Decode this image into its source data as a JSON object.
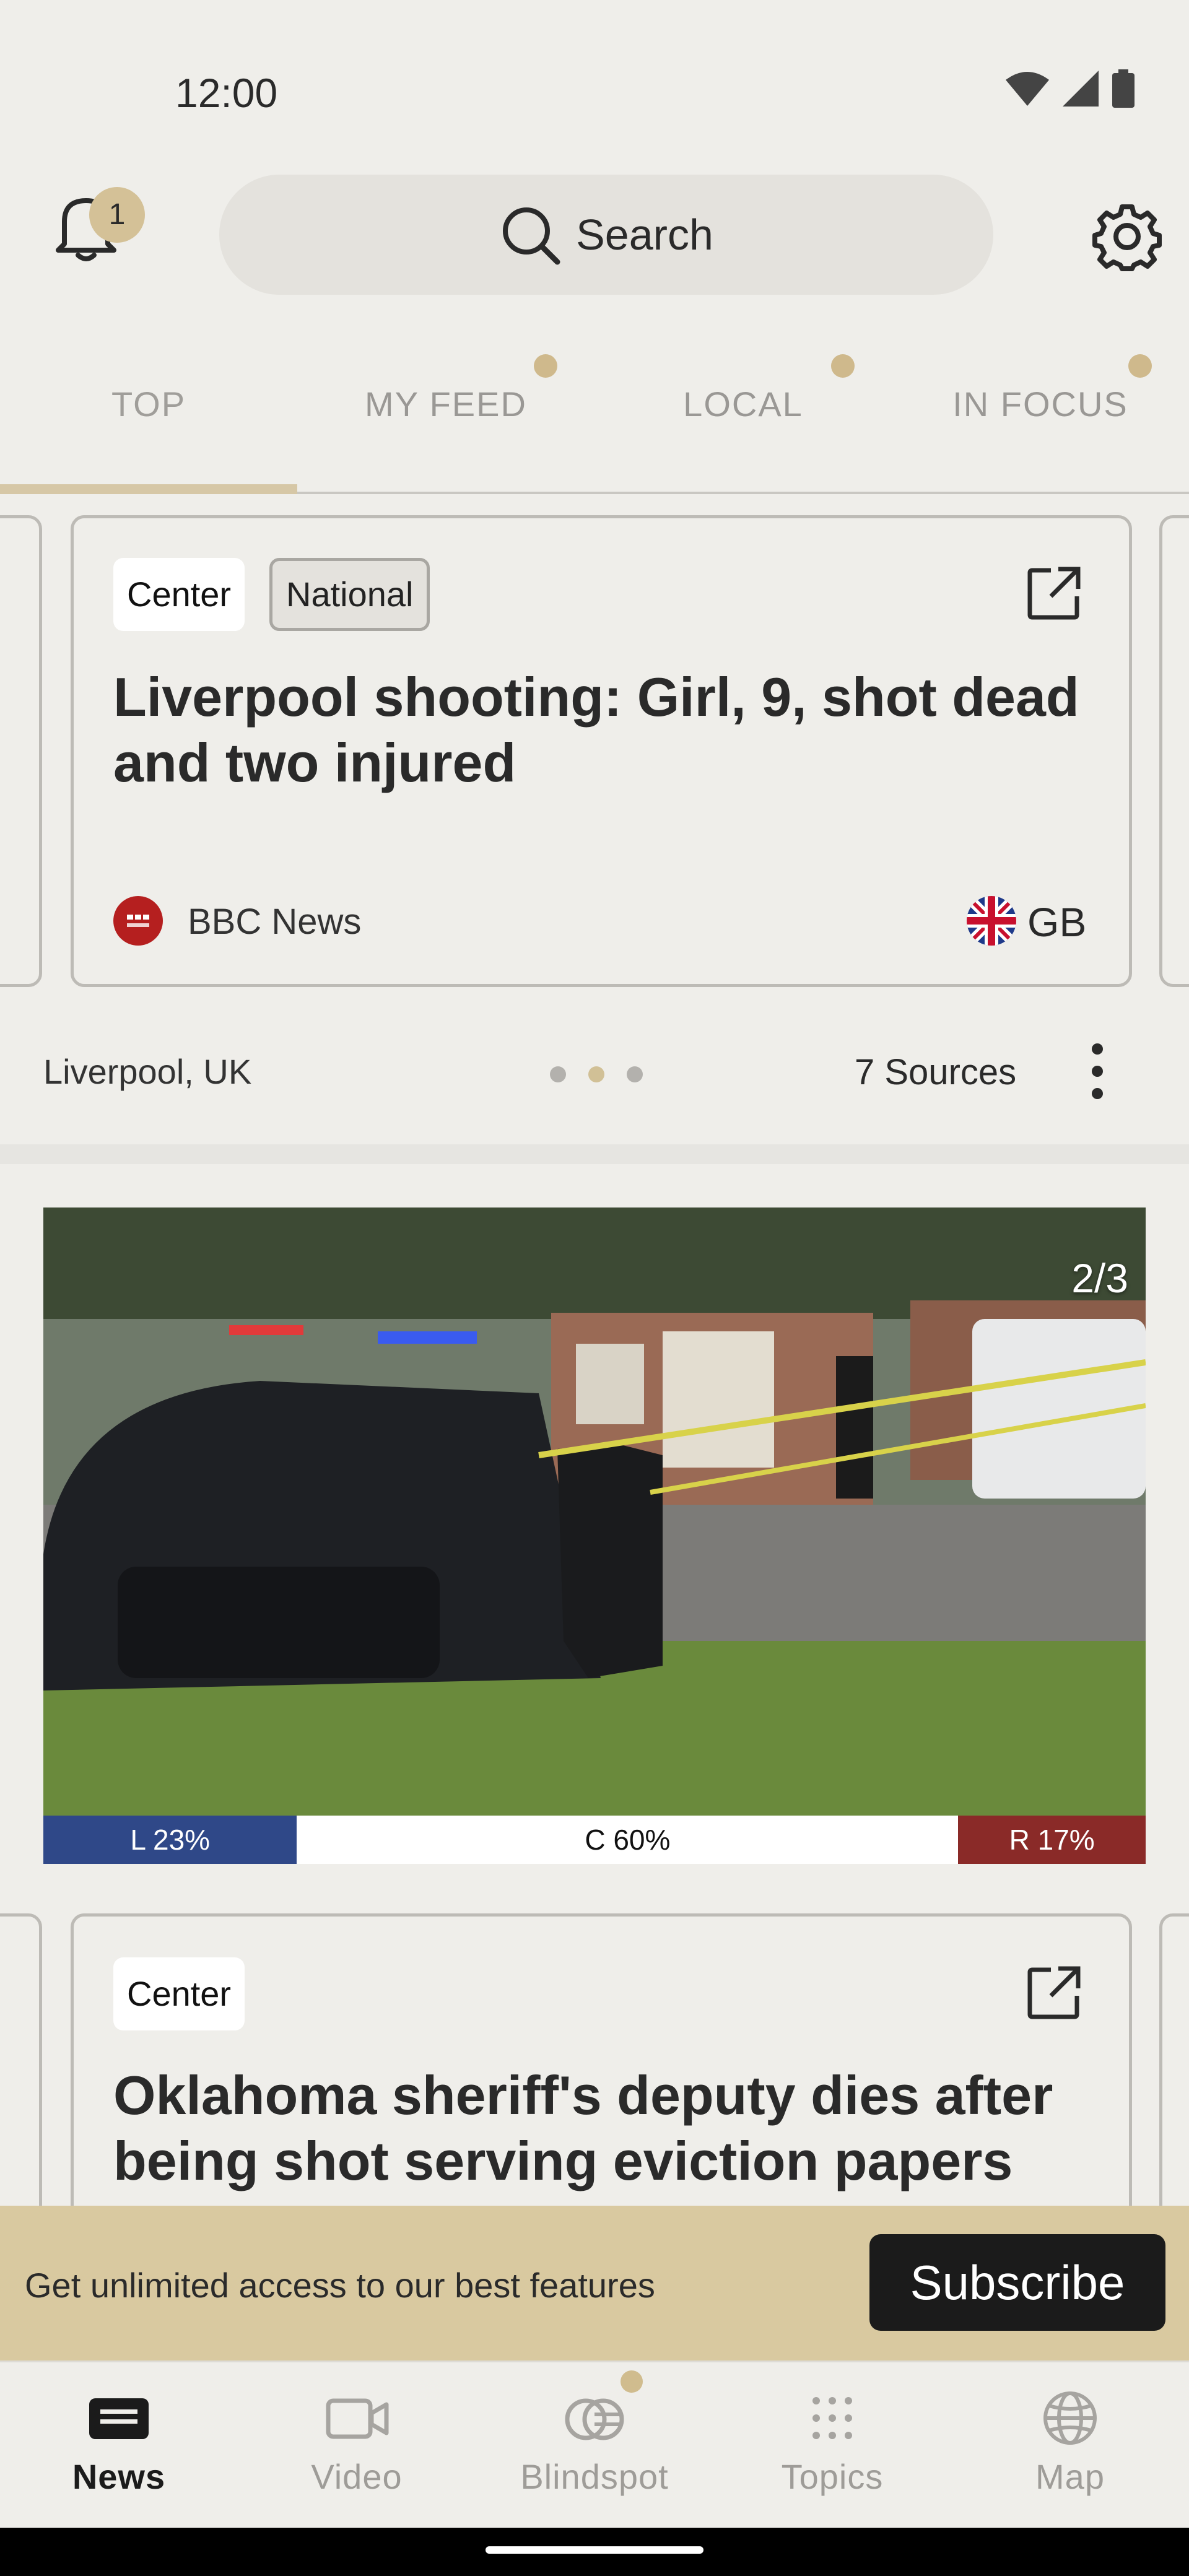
{
  "status_bar": {
    "time": "12:00"
  },
  "header": {
    "notification_count": "1",
    "search_placeholder": "Search"
  },
  "tabs": [
    {
      "label": "TOP",
      "active": true,
      "has_dot": false
    },
    {
      "label": "MY FEED",
      "active": false,
      "has_dot": true
    },
    {
      "label": "LOCAL",
      "active": false,
      "has_dot": true
    },
    {
      "label": "IN FOCUS",
      "active": false,
      "has_dot": true
    }
  ],
  "story1": {
    "tags": [
      "Center",
      "National"
    ],
    "headline": "Liverpool shooting: Girl, 9, shot dead and two injured",
    "source_name": "BBC News",
    "country": "GB",
    "location": "Liverpool, UK",
    "sources_count": "7 Sources",
    "carousel_active_index": 1,
    "carousel_total": 3
  },
  "story2": {
    "image_counter": "2/3",
    "bias": {
      "left": "L 23%",
      "center": "C 60%",
      "right": "R 17%",
      "left_pct": 23,
      "center_pct": 60,
      "right_pct": 17
    },
    "tag": "Center",
    "headline": "Oklahoma sheriff's deputy dies after being shot serving eviction papers"
  },
  "banner": {
    "text": "Get unlimited access to our best features",
    "button": "Subscribe"
  },
  "bottom_nav": [
    {
      "label": "News",
      "icon": "news-icon",
      "active": true
    },
    {
      "label": "Video",
      "icon": "video-icon",
      "active": false
    },
    {
      "label": "Blindspot",
      "icon": "blindspot-icon",
      "active": false
    },
    {
      "label": "Topics",
      "icon": "topics-icon",
      "active": false
    },
    {
      "label": "Map",
      "icon": "globe-icon",
      "active": false
    }
  ],
  "colors": {
    "accent": "#d6c7a6",
    "bias_left": "#2f4888",
    "bias_center": "#ffffff",
    "bias_right": "#8a2a28",
    "banner": "#d9c9a0"
  }
}
